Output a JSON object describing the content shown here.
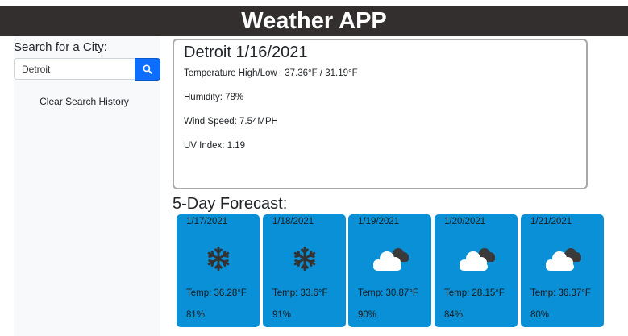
{
  "header": {
    "title": "Weather APP"
  },
  "sidebar": {
    "search_label": "Search for a City:",
    "search_value": "Detroit",
    "search_icon": "search-icon",
    "clear_label": "Clear Search History"
  },
  "current": {
    "title": "Detroit 1/16/2021",
    "temperature": "Temperature High/Low : 37.36°F / 31.19°F",
    "humidity": "Humidity: 78%",
    "wind": "Wind Speed: 7.54MPH",
    "uv": "UV Index: 1.19"
  },
  "forecast": {
    "title": "5-Day Forecast:",
    "days": [
      {
        "date": "1/17/2021",
        "icon": "snowflake-icon",
        "temp": "Temp: 36.28°F",
        "humidity": "81%"
      },
      {
        "date": "1/18/2021",
        "icon": "snowflake-icon",
        "temp": "Temp: 33.6°F",
        "humidity": "91%"
      },
      {
        "date": "1/19/2021",
        "icon": "cloud-icon",
        "temp": "Temp: 30.87°F",
        "humidity": "90%"
      },
      {
        "date": "1/20/2021",
        "icon": "cloud-icon",
        "temp": "Temp: 28.15°F",
        "humidity": "84%"
      },
      {
        "date": "1/21/2021",
        "icon": "cloud-icon",
        "temp": "Temp: 36.37°F",
        "humidity": "80%"
      }
    ]
  },
  "colors": {
    "header_bg": "#322f2e",
    "card_bg": "#0a90d6",
    "button_bg": "#0d6efd"
  }
}
